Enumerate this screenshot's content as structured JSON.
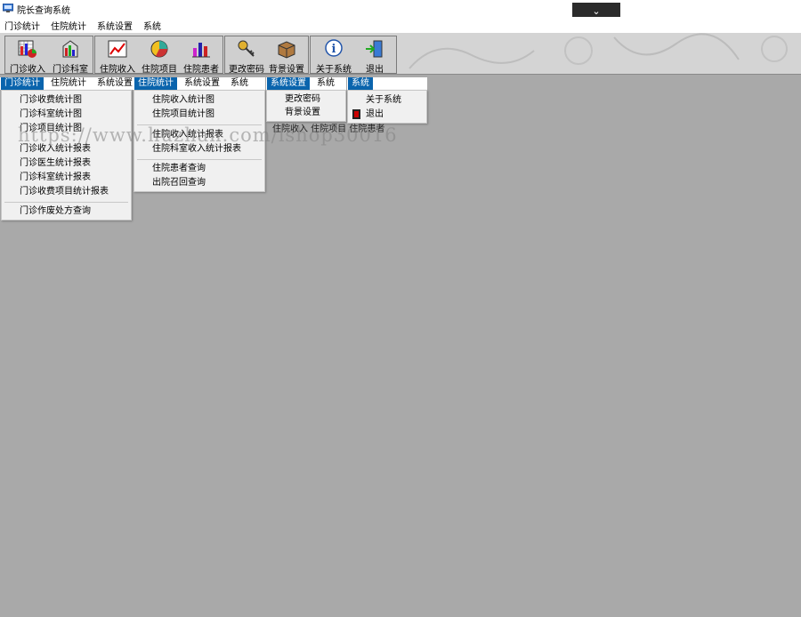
{
  "window": {
    "title": "院长查询系统"
  },
  "menubar": [
    "门诊统计",
    "住院统计",
    "系统设置",
    "系统"
  ],
  "toolbar": [
    {
      "label": "门诊收入",
      "icon": "outpatient-income-icon"
    },
    {
      "label": "门诊科室",
      "icon": "outpatient-dept-icon"
    },
    {
      "label": "住院收入",
      "icon": "inpatient-income-icon"
    },
    {
      "label": "住院项目",
      "icon": "inpatient-items-icon"
    },
    {
      "label": "住院患者",
      "icon": "inpatient-patients-icon"
    },
    {
      "label": "更改密码",
      "icon": "key-icon"
    },
    {
      "label": "背景设置",
      "icon": "box-icon"
    },
    {
      "label": "关于系统",
      "icon": "info-icon"
    },
    {
      "label": "退出",
      "icon": "exit-door-icon"
    }
  ],
  "panel1": {
    "menus": [
      "门诊统计",
      "住院统计",
      "系统设置"
    ],
    "items": [
      "门诊收费统计图",
      "门诊科室统计图",
      "门诊项目统计图",
      "门诊收入统计报表",
      "门诊医生统计报表",
      "门诊科室统计报表",
      "门诊收费项目统计报表",
      "门诊作废处方查询"
    ]
  },
  "panel2": {
    "menus": [
      "住院统计",
      "系统设置",
      "系统"
    ],
    "items": [
      "住院收入统计图",
      "住院项目统计图",
      "住院收入统计报表",
      "住院科室收入统计报表",
      "住院患者查询",
      "出院召回查询"
    ]
  },
  "panel3": {
    "menus": [
      "系统设置",
      "系统"
    ],
    "items": [
      "更改密码",
      "背景设置"
    ]
  },
  "panel4": {
    "menus": [
      "系统"
    ],
    "items": [
      "关于系统",
      "退出"
    ]
  },
  "behind_text": "住院收入 住院项目 住院患者",
  "watermark": "https://www.huzhan.com/ishop30016"
}
